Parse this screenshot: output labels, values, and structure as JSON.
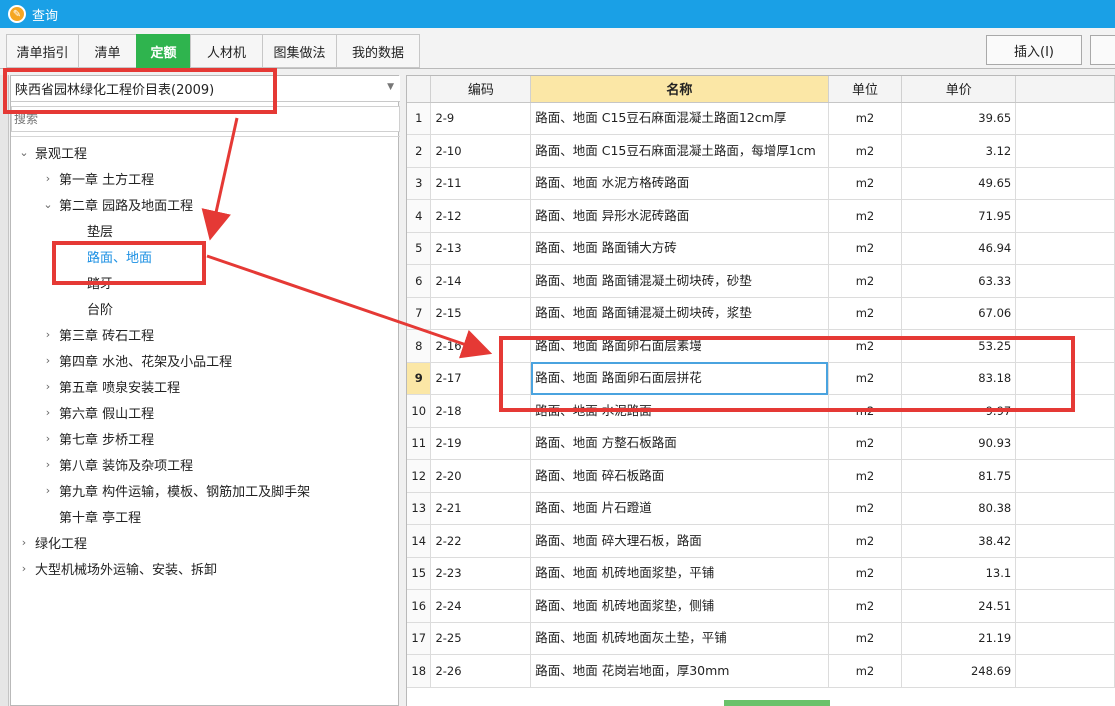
{
  "window": {
    "title": "查询"
  },
  "tabs": [
    "清单指引",
    "清单",
    "定额",
    "人材机",
    "图集做法",
    "我的数据"
  ],
  "active_tab": "定额",
  "toolbar": {
    "insert_label": "插入(I)"
  },
  "left_panel": {
    "dropdown_value": "陕西省园林绿化工程价目表(2009)",
    "search_placeholder": "搜索",
    "tree": [
      {
        "label": "景观工程",
        "level": 0,
        "state": "expanded"
      },
      {
        "label": "第一章 土方工程",
        "level": 1,
        "state": "collapsed"
      },
      {
        "label": "第二章 园路及地面工程",
        "level": 1,
        "state": "expanded"
      },
      {
        "label": "垫层",
        "level": 2,
        "state": "leaf"
      },
      {
        "label": "路面、地面",
        "level": 2,
        "state": "leaf",
        "selected": true
      },
      {
        "label": "踏牙",
        "level": 2,
        "state": "leaf"
      },
      {
        "label": "台阶",
        "level": 2,
        "state": "leaf"
      },
      {
        "label": "第三章 砖石工程",
        "level": 1,
        "state": "collapsed"
      },
      {
        "label": "第四章 水池、花架及小品工程",
        "level": 1,
        "state": "collapsed"
      },
      {
        "label": "第五章 喷泉安装工程",
        "level": 1,
        "state": "collapsed"
      },
      {
        "label": "第六章 假山工程",
        "level": 1,
        "state": "collapsed"
      },
      {
        "label": "第七章 步桥工程",
        "level": 1,
        "state": "collapsed"
      },
      {
        "label": "第八章 装饰及杂项工程",
        "level": 1,
        "state": "collapsed"
      },
      {
        "label": "第九章 构件运输，模板、钢筋加工及脚手架",
        "level": 1,
        "state": "collapsed"
      },
      {
        "label": "第十章 亭工程",
        "level": 1,
        "state": "leaf"
      },
      {
        "label": "绿化工程",
        "level": 0,
        "state": "collapsed"
      },
      {
        "label": "大型机械场外运输、安装、拆卸",
        "level": 0,
        "state": "collapsed"
      }
    ]
  },
  "grid": {
    "columns": [
      "编码",
      "名称",
      "单位",
      "单价"
    ],
    "current_row": 9,
    "rows": [
      {
        "n": "1",
        "code": "2-9",
        "name": "路面、地面 C15豆石麻面混凝土路面12cm厚",
        "unit": "m2",
        "price": "39.65"
      },
      {
        "n": "2",
        "code": "2-10",
        "name": "路面、地面 C15豆石麻面混凝土路面，每增厚1cm",
        "unit": "m2",
        "price": "3.12"
      },
      {
        "n": "3",
        "code": "2-11",
        "name": "路面、地面 水泥方格砖路面",
        "unit": "m2",
        "price": "49.65"
      },
      {
        "n": "4",
        "code": "2-12",
        "name": "路面、地面 异形水泥砖路面",
        "unit": "m2",
        "price": "71.95"
      },
      {
        "n": "5",
        "code": "2-13",
        "name": "路面、地面 路面铺大方砖",
        "unit": "m2",
        "price": "46.94"
      },
      {
        "n": "6",
        "code": "2-14",
        "name": "路面、地面 路面铺混凝土砌块砖，砂垫",
        "unit": "m2",
        "price": "63.33"
      },
      {
        "n": "7",
        "code": "2-15",
        "name": "路面、地面 路面铺混凝土砌块砖，浆垫",
        "unit": "m2",
        "price": "67.06"
      },
      {
        "n": "8",
        "code": "2-16",
        "name": "路面、地面 路面卵石面层素墁",
        "unit": "m2",
        "price": "53.25"
      },
      {
        "n": "9",
        "code": "2-17",
        "name": "路面、地面 路面卵石面层拼花",
        "unit": "m2",
        "price": "83.18"
      },
      {
        "n": "10",
        "code": "2-18",
        "name": "路面、地面 水泥路面",
        "unit": "m2",
        "price": "9.97"
      },
      {
        "n": "11",
        "code": "2-19",
        "name": "路面、地面 方整石板路面",
        "unit": "m2",
        "price": "90.93"
      },
      {
        "n": "12",
        "code": "2-20",
        "name": "路面、地面 碎石板路面",
        "unit": "m2",
        "price": "81.75"
      },
      {
        "n": "13",
        "code": "2-21",
        "name": "路面、地面 片石蹬道",
        "unit": "m2",
        "price": "80.38"
      },
      {
        "n": "14",
        "code": "2-22",
        "name": "路面、地面 碎大理石板，路面",
        "unit": "m2",
        "price": "38.42"
      },
      {
        "n": "15",
        "code": "2-23",
        "name": "路面、地面 机砖地面浆垫，平铺",
        "unit": "m2",
        "price": "13.1"
      },
      {
        "n": "16",
        "code": "2-24",
        "name": "路面、地面 机砖地面浆垫，侧铺",
        "unit": "m2",
        "price": "24.51"
      },
      {
        "n": "17",
        "code": "2-25",
        "name": "路面、地面 机砖地面灰土垫，平铺",
        "unit": "m2",
        "price": "21.19"
      },
      {
        "n": "18",
        "code": "2-26",
        "name": "路面、地面 花岗岩地面，厚30mm",
        "unit": "m2",
        "price": "248.69"
      }
    ]
  },
  "annotation_color": "#e53935"
}
